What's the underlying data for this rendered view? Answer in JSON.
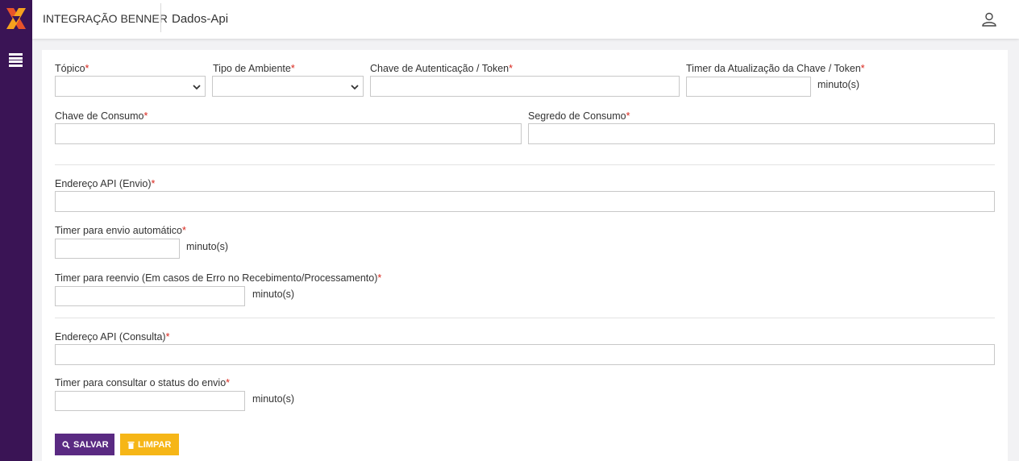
{
  "app": {
    "title": "INTEGRAÇÃO BENNER",
    "page_title": "Dados-Api"
  },
  "form": {
    "topico": {
      "label": "Tópico",
      "required": "*",
      "value": ""
    },
    "tipo_ambiente": {
      "label": "Tipo de Ambiente",
      "required": "*",
      "value": ""
    },
    "chave_autenticacao": {
      "label": "Chave de Autenticação / Token",
      "required": "*",
      "value": ""
    },
    "timer_atualizacao": {
      "label": "Timer da Atualização da Chave / Token",
      "required": "*",
      "value": "",
      "unit": "minuto(s)"
    },
    "chave_consumo": {
      "label": "Chave de Consumo",
      "required": "*",
      "value": ""
    },
    "segredo_consumo": {
      "label": "Segredo de Consumo",
      "required": "*",
      "value": ""
    },
    "endereco_envio": {
      "label": "Endereço API (Envio)",
      "required": "*",
      "value": ""
    },
    "timer_envio": {
      "label": "Timer para envio automático",
      "required": "*",
      "value": "",
      "unit": "minuto(s)"
    },
    "timer_reenvio": {
      "label": "Timer para reenvio (Em casos de Erro no Recebimento/Processamento)",
      "required": "*",
      "value": "",
      "unit": "minuto(s)"
    },
    "endereco_consulta": {
      "label": "Endereço API (Consulta)",
      "required": "*",
      "value": ""
    },
    "timer_consulta": {
      "label": "Timer para consultar o status do envio",
      "required": "*",
      "value": "",
      "unit": "minuto(s)"
    }
  },
  "actions": {
    "save_label": "SALVAR",
    "clear_label": "LIMPAR"
  },
  "colors": {
    "sidebar": "#3a1455",
    "save": "#5a2a82",
    "clear": "#f6b617",
    "required": "#d9261c"
  },
  "icons": {
    "logo": "benner-logo",
    "menu": "menu-icon",
    "user": "user-icon",
    "save": "search-icon",
    "clear": "trash-icon"
  }
}
